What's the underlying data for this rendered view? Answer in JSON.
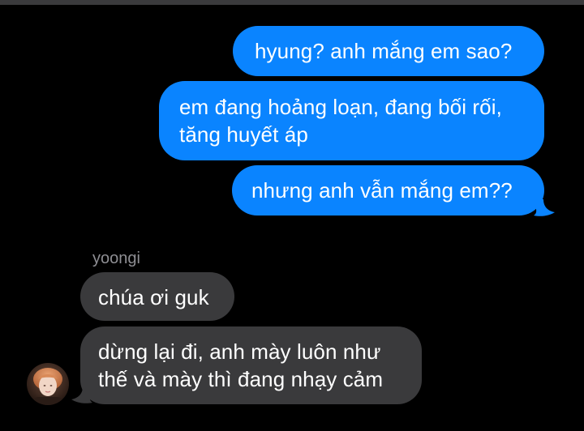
{
  "conversation": {
    "sent_messages": [
      {
        "text": "hyung? anh mắng em sao?"
      },
      {
        "line1": "em đang hoảng loạn, đang bối rối,",
        "line2": "tăng huyết áp"
      },
      {
        "text": "nhưng anh vẫn mắng em??"
      }
    ],
    "received": {
      "sender_name": "yoongi",
      "messages": [
        {
          "text": "chúa ơi guk"
        },
        {
          "line1": "dừng lại đi, anh mày luôn như",
          "line2": "thế và mày thì đang nhạy cảm"
        }
      ]
    }
  },
  "colors": {
    "background": "#000000",
    "sent_bubble": "#0a84ff",
    "received_bubble": "#3a3a3c",
    "sender_name": "#8e8e93",
    "text": "#ffffff"
  },
  "icons": {
    "avatar": "contact-avatar-icon"
  }
}
